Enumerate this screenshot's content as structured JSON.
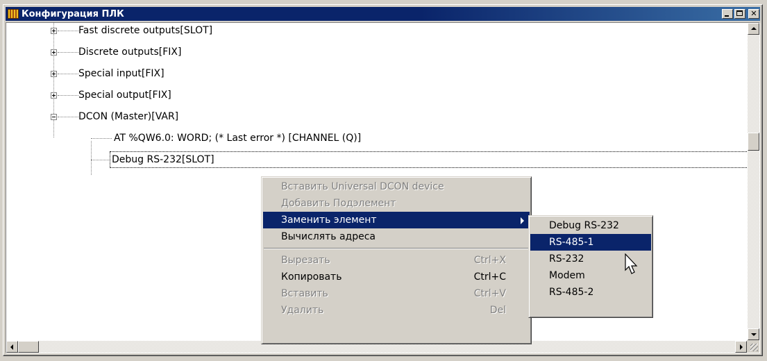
{
  "window": {
    "title": "Конфигурация ПЛК"
  },
  "tree": {
    "items": [
      {
        "label": "Fast discrete outputs[SLOT]",
        "expander": "plus"
      },
      {
        "label": "Discrete outputs[FIX]",
        "expander": "plus"
      },
      {
        "label": "Special input[FIX]",
        "expander": "plus"
      },
      {
        "label": "Special output[FIX]",
        "expander": "plus"
      },
      {
        "label": "DCON (Master)[VAR]",
        "expander": "minus"
      },
      {
        "label": "AT %QW6.0: WORD; (* Last error *) [CHANNEL (Q)]"
      },
      {
        "label": "Debug RS-232[SLOT]",
        "focused": true
      }
    ]
  },
  "context_menu": {
    "items": [
      {
        "label": "Вставить Universal DCON device",
        "disabled": true
      },
      {
        "label": "Добавить Подэлемент",
        "disabled": true
      },
      {
        "label": "Заменить элемент",
        "highlighted": true,
        "submenu": true
      },
      {
        "label": "Вычислять адреса"
      },
      {
        "label": "Вырезать",
        "shortcut": "Ctrl+X",
        "disabled": true
      },
      {
        "label": "Копировать",
        "shortcut": "Ctrl+C"
      },
      {
        "label": "Вставить",
        "shortcut": "Ctrl+V",
        "disabled": true
      },
      {
        "label": "Удалить",
        "shortcut": "Del",
        "disabled": true
      }
    ]
  },
  "submenu": {
    "items": [
      {
        "label": "Debug RS-232"
      },
      {
        "label": "RS-485-1",
        "highlighted": true
      },
      {
        "label": "RS-232"
      },
      {
        "label": "Modem"
      },
      {
        "label": "RS-485-2"
      }
    ]
  },
  "colors": {
    "selection": "#0a246a",
    "titlebar": "#0a246a",
    "face": "#d4d0c8"
  }
}
